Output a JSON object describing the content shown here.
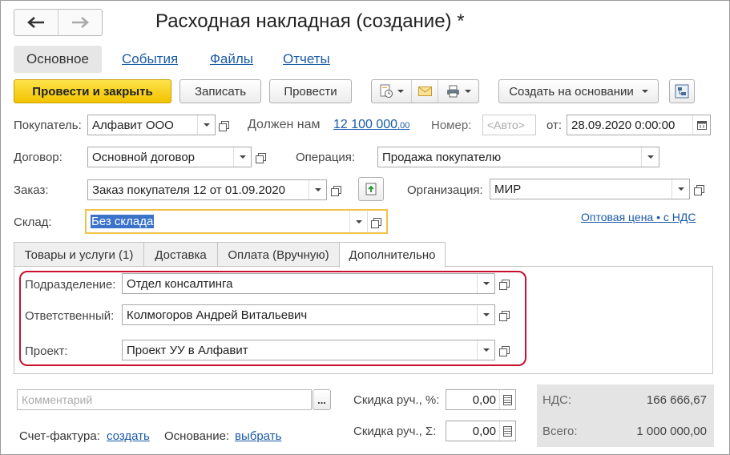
{
  "window": {
    "title": "Расходная накладная (создание) *"
  },
  "nav": {
    "back_icon": "arrow-left-icon",
    "forward_icon": "arrow-right-icon"
  },
  "tabs": [
    {
      "label": "Основное",
      "active": true
    },
    {
      "label": "События",
      "active": false
    },
    {
      "label": "Файлы",
      "active": false
    },
    {
      "label": "Отчеты",
      "active": false
    }
  ],
  "toolbar": {
    "post_close": "Провести и закрыть",
    "save": "Записать",
    "post": "Провести",
    "create_based": "Создать на основании"
  },
  "header": {
    "buyer_label": "Покупатель:",
    "buyer_value": "Алфавит ООО",
    "debt_label": "Должен нам",
    "debt_main": "12 100 000",
    "debt_cents": ",00",
    "number_label": "Номер:",
    "number_placeholder": "<Авто>",
    "date_label": "от:",
    "date_value": "28.09.2020  0:00:00",
    "contract_label": "Договор:",
    "contract_value": "Основной договор",
    "operation_label": "Операция:",
    "operation_value": "Продажа покупателю",
    "order_label": "Заказ:",
    "order_value": "Заказ покупателя 12 от 01.09.2020",
    "org_label": "Организация:",
    "org_value": "МИР",
    "warehouse_label": "Склад:",
    "warehouse_value": "Без склада",
    "price_link": "Оптовая цена • с НДС"
  },
  "page_tabs": [
    {
      "label": "Товары и услуги (1)"
    },
    {
      "label": "Доставка"
    },
    {
      "label": "Оплата (Вручную)"
    },
    {
      "label": "Дополнительно",
      "active": true
    }
  ],
  "additional": {
    "division_label": "Подразделение:",
    "division_value": "Отдел консалтинга",
    "responsible_label": "Ответственный:",
    "responsible_value": "Колмогоров Андрей Витальевич",
    "project_label": "Проект:",
    "project_value": "Проект УУ в Алфавит"
  },
  "footer": {
    "comment_placeholder": "Комментарий",
    "comment_btn": "...",
    "discount_pct_label": "Скидка руч., %:",
    "discount_pct_value": "0,00",
    "discount_sum_label": "Скидка руч., Σ:",
    "discount_sum_value": "0,00",
    "invoice_label": "Счет-фактура:",
    "invoice_link": "создать",
    "basis_label": "Основание:",
    "basis_link": "выбрать",
    "vat_label": "НДС:",
    "vat_value": "166 666,67",
    "total_label": "Всего:",
    "total_value": "1 000 000,00"
  },
  "colors": {
    "accent_yellow": "#f2c200",
    "link_blue": "#1a5aa8",
    "highlight_red": "#c8102e",
    "focus_border": "#f0c24a"
  }
}
